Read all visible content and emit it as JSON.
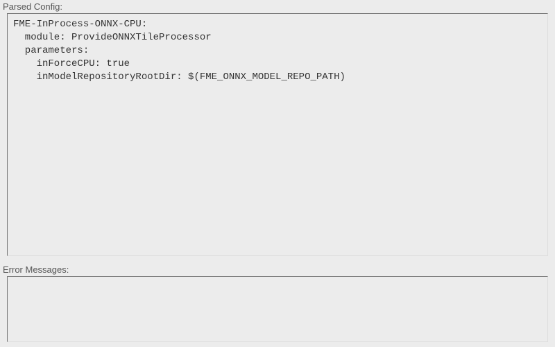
{
  "parsed_config": {
    "label": "Parsed Config:",
    "content": "FME-InProcess-ONNX-CPU:\n  module: ProvideONNXTileProcessor\n  parameters:\n    inForceCPU: true\n    inModelRepositoryRootDir: $(FME_ONNX_MODEL_REPO_PATH)"
  },
  "error_messages": {
    "label": "Error Messages:",
    "content": ""
  }
}
